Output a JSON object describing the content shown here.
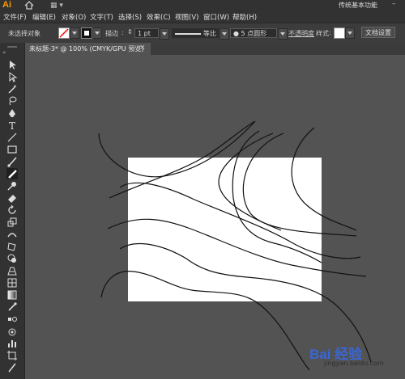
{
  "app": {
    "logo": "Ai",
    "workspace": "传统基本功能",
    "min_btn": "–"
  },
  "menu": [
    "文件(F)",
    "编辑(E)",
    "对象(O)",
    "文字(T)",
    "选择(S)",
    "效果(C)",
    "视图(V)",
    "窗口(W)",
    "帮助(H)"
  ],
  "control": {
    "selection_status": "未选择对象",
    "stroke_label": "描边",
    "stroke_weight": "1 pt",
    "profile": "等比",
    "brush": "5 点圆形",
    "opacity_label": "不透明度",
    "style_label": "样式",
    "doc_settings": "文档设置"
  },
  "tab": {
    "label": "未标题-3* @ 100% (CMYK/GPU 预览)",
    "close": "×"
  },
  "watermark": {
    "brand": "Bai 经验",
    "url": "jingyan.baidu.com"
  },
  "colors": {
    "panel": "#323232",
    "canvas": "#535353",
    "artboard": "#ffffff",
    "accent": "#ff9a00"
  },
  "tools": [
    "selection-tool-icon",
    "direct-selection-tool-icon",
    "magic-wand-tool-icon",
    "lasso-tool-icon",
    "pen-tool-icon",
    "type-tool-icon",
    "line-segment-tool-icon",
    "rectangle-tool-icon",
    "paintbrush-tool-icon",
    "pencil-tool-icon",
    "blob-brush-tool-icon",
    "eraser-tool-icon",
    "rotate-tool-icon",
    "scale-tool-icon",
    "width-tool-icon",
    "free-transform-tool-icon",
    "shape-builder-tool-icon",
    "perspective-grid-tool-icon",
    "mesh-tool-icon",
    "gradient-tool-icon",
    "eyedropper-tool-icon",
    "blend-tool-icon",
    "symbol-sprayer-tool-icon",
    "column-graph-tool-icon",
    "artboard-tool-icon",
    "slice-tool-icon"
  ]
}
